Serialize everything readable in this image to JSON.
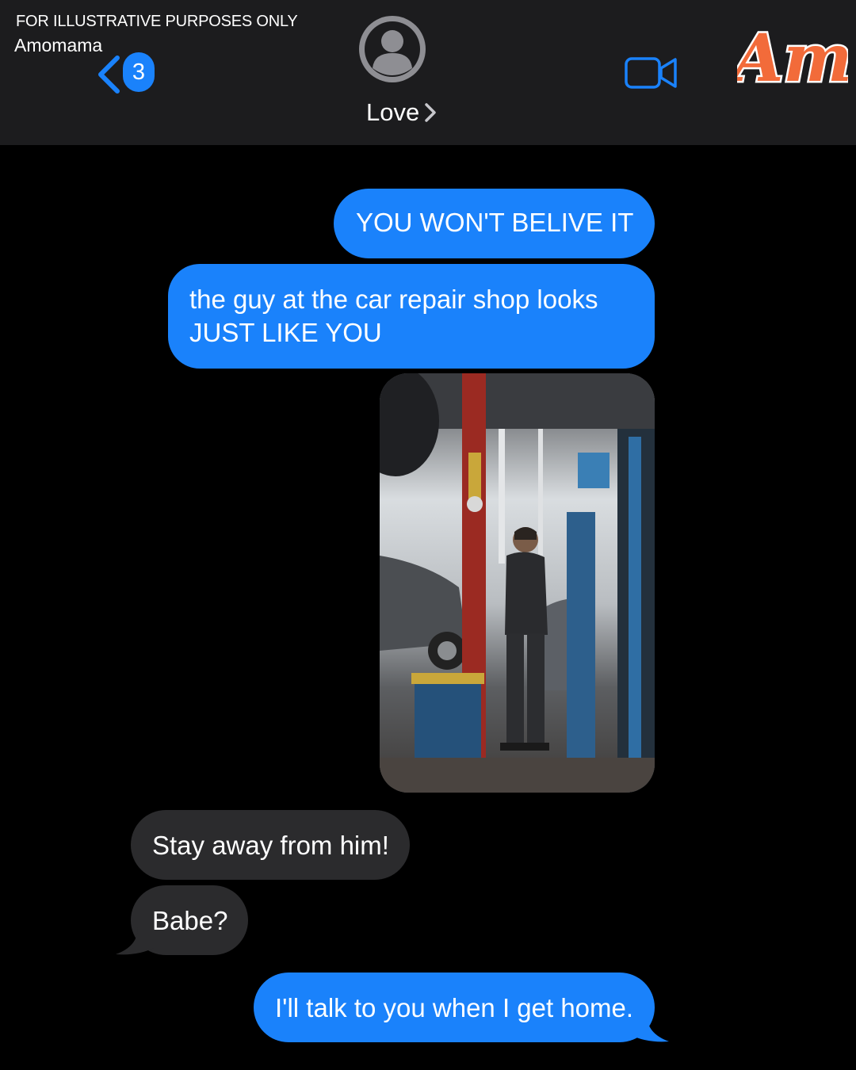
{
  "header": {
    "disclaimer": "FOR ILLUSTRATIVE PURPOSES ONLY",
    "brand": "Amomama",
    "back_badge_count": "3",
    "contact_name": "Love",
    "logo_text": "Am",
    "icons": [
      "chevron-left-icon",
      "person-avatar-icon",
      "chevron-right-icon",
      "video-camera-icon"
    ]
  },
  "messages": [
    {
      "direction": "outgoing",
      "text": "YOU WON'T BELIVE IT"
    },
    {
      "direction": "outgoing",
      "text": "the guy at the car repair shop looks JUST LIKE YOU"
    },
    {
      "direction": "outgoing",
      "type": "photo"
    },
    {
      "direction": "incoming",
      "text": "Stay away from him!"
    },
    {
      "direction": "incoming",
      "text": "Babe?"
    },
    {
      "direction": "outgoing",
      "text": "I'll talk to you when I get home."
    }
  ],
  "colors": {
    "outgoing_bubble": "#1a82fb",
    "incoming_bubble": "#2b2b2d",
    "header_bg": "#1c1c1e",
    "logo": "#f26b3a"
  }
}
